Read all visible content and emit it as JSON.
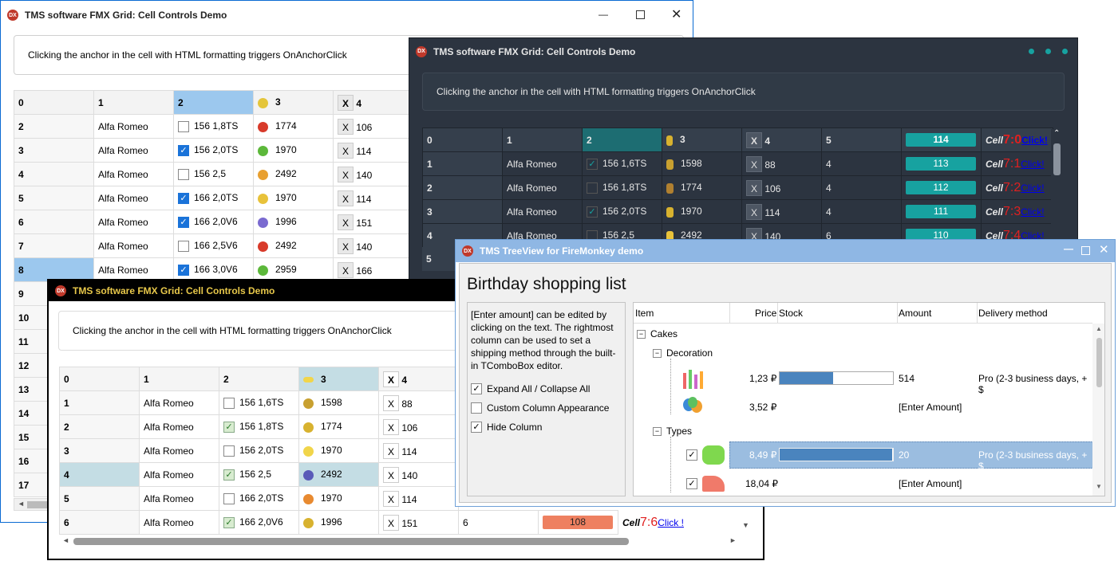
{
  "w1": {
    "title": "TMS software FMX Grid: Cell Controls Demo",
    "hint": "Clicking the anchor in the cell with HTML formatting triggers OnAnchorClick",
    "header": [
      "0",
      "1",
      "2",
      "3",
      "4"
    ],
    "rows": [
      {
        "n": "2",
        "make": "Alfa Romeo",
        "chk": false,
        "model": "156 1,8TS",
        "num": "1774",
        "x": "X",
        "v": "106"
      },
      {
        "n": "3",
        "make": "Alfa Romeo",
        "chk": true,
        "model": "156 2,0TS",
        "num": "1970",
        "x": "X",
        "v": "114"
      },
      {
        "n": "4",
        "make": "Alfa Romeo",
        "chk": false,
        "model": "156 2,5",
        "num": "2492",
        "x": "X",
        "v": "140"
      },
      {
        "n": "5",
        "make": "Alfa Romeo",
        "chk": true,
        "model": "166 2,0TS",
        "num": "1970",
        "x": "X",
        "v": "114"
      },
      {
        "n": "6",
        "make": "Alfa Romeo",
        "chk": true,
        "model": "166 2,0V6",
        "num": "1996",
        "x": "X",
        "v": "151"
      },
      {
        "n": "7",
        "make": "Alfa Romeo",
        "chk": false,
        "model": "166 2,5V6",
        "num": "2492",
        "x": "X",
        "v": "140"
      },
      {
        "n": "8",
        "make": "Alfa Romeo",
        "chk": true,
        "model": "166 3,0V6",
        "num": "2959",
        "x": "X",
        "v": "166"
      }
    ],
    "extra_rows": [
      "9",
      "10",
      "11",
      "12",
      "13",
      "14",
      "15",
      "16",
      "17"
    ]
  },
  "w2": {
    "title": "TMS software FMX Grid: Cell Controls Demo",
    "hint": "Clicking the anchor in the cell with HTML formatting triggers OnAnchorClick",
    "header": {
      "c0": "0",
      "c1": "1",
      "c2": "2",
      "c3": "3",
      "x": "X",
      "c4": "4",
      "c5": "5",
      "bar": "114",
      "cell": "Cell",
      "idx": "7:0",
      "link": "Click!"
    },
    "rows": [
      {
        "n": "1",
        "make": "Alfa Romeo",
        "chk": true,
        "model": "156 1,6TS",
        "num": "1598",
        "x": "X",
        "v": "88",
        "c5": "4",
        "bar": "113",
        "cell": "Cell",
        "idx": "7:1",
        "link": "Click!"
      },
      {
        "n": "2",
        "make": "Alfa Romeo",
        "chk": false,
        "model": "156 1,8TS",
        "num": "1774",
        "x": "X",
        "v": "106",
        "c5": "4",
        "bar": "112",
        "cell": "Cell",
        "idx": "7:2",
        "link": "Click!"
      },
      {
        "n": "3",
        "make": "Alfa Romeo",
        "chk": true,
        "model": "156 2,0TS",
        "num": "1970",
        "x": "X",
        "v": "114",
        "c5": "4",
        "bar": "111",
        "cell": "Cell",
        "idx": "7:3",
        "link": "Click!"
      },
      {
        "n": "4",
        "make": "Alfa Romeo",
        "chk": false,
        "model": "156 2,5",
        "num": "2492",
        "x": "X",
        "v": "140",
        "c5": "6",
        "bar": "110",
        "cell": "Cell",
        "idx": "7:4",
        "link": "Click!"
      }
    ],
    "last_row": "5"
  },
  "w3": {
    "title": "TMS software FMX Grid: Cell Controls Demo",
    "hint": "Clicking the anchor in the cell with HTML formatting triggers OnAnchorClick",
    "header": [
      "0",
      "1",
      "2",
      "3",
      "X",
      "4"
    ],
    "rows": [
      {
        "n": "1",
        "make": "Alfa Romeo",
        "chk": false,
        "model": "156 1,6TS",
        "num": "1598",
        "x": "X",
        "v": "88"
      },
      {
        "n": "2",
        "make": "Alfa Romeo",
        "chk": true,
        "model": "156 1,8TS",
        "num": "1774",
        "x": "X",
        "v": "106"
      },
      {
        "n": "3",
        "make": "Alfa Romeo",
        "chk": false,
        "model": "156 2,0TS",
        "num": "1970",
        "x": "X",
        "v": "114"
      },
      {
        "n": "4",
        "make": "Alfa Romeo",
        "chk": true,
        "model": "156 2,5",
        "num": "2492",
        "x": "X",
        "v": "140"
      },
      {
        "n": "5",
        "make": "Alfa Romeo",
        "chk": false,
        "model": "166 2,0TS",
        "num": "1970",
        "x": "X",
        "v": "114"
      },
      {
        "n": "6",
        "make": "Alfa Romeo",
        "chk": true,
        "model": "166 2,0V6",
        "num": "1996",
        "x": "X",
        "v": "151",
        "c5": "6",
        "bar": "108",
        "cell": "Cell",
        "idx": "7:6",
        "link": "Click !"
      }
    ]
  },
  "w4": {
    "title": "TMS TreeView for FireMonkey demo",
    "heading": "Birthday shopping list",
    "desc": "[Enter amount] can be edited by clicking on the text. The rightmost column can be used to set a shipping method through the built-in TComboBox editor.",
    "options": [
      {
        "label": "Expand All / Collapse All",
        "checked": true
      },
      {
        "label": "Custom Column Appearance",
        "checked": false
      },
      {
        "label": "Hide Column",
        "checked": true
      }
    ],
    "columns": {
      "item": "Item",
      "price": "Price",
      "stock": "Stock",
      "amount": "Amount",
      "delivery": "Delivery method"
    },
    "groups": {
      "cakes": "Cakes",
      "decoration": "Decoration",
      "types": "Types"
    },
    "items": [
      {
        "price": "1,23 ₽",
        "stock_fraction": 0.47,
        "amount": "514",
        "delivery": "Pro (2-3 business days, + $"
      },
      {
        "price": "3,52 ₽",
        "amount": "[Enter Amount]"
      },
      {
        "price": "8,49 ₽",
        "stock_fraction": 0.99,
        "amount": "20",
        "delivery": "Pro (2-3 business days, + $"
      },
      {
        "price": "18,04 ₽",
        "amount": "[Enter Amount]"
      }
    ]
  },
  "colors": {
    "blue_title": "#0a6ad2",
    "dark_bg": "#2c3440",
    "teal": "#17a2a0",
    "orange_bar": "#ee8060",
    "tree_blue": "#4a84be"
  }
}
